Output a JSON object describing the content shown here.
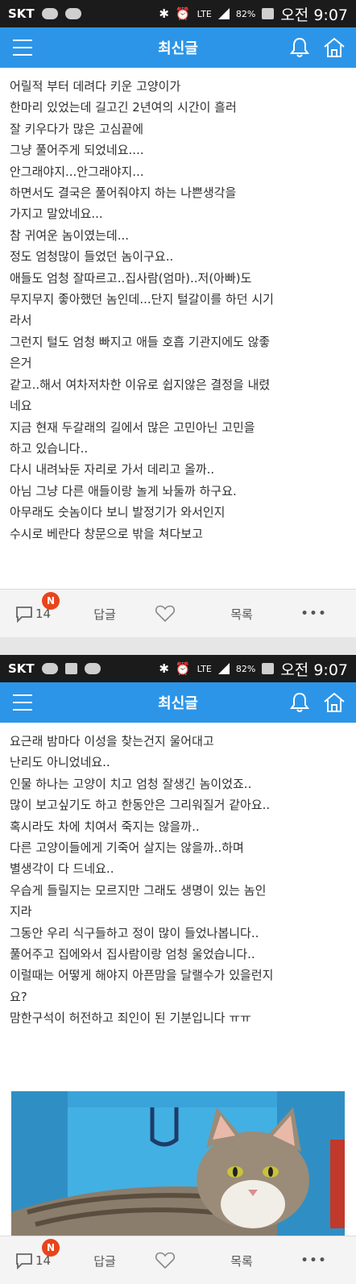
{
  "status_bar": {
    "carrier": "SKT",
    "network": "LTE",
    "battery": "82%",
    "time": "오전 9:07"
  },
  "header": {
    "title": "최신글"
  },
  "post": {
    "paragraphs_part1": [
      "어릴적 부터 데려다 키운 고양이가",
      "한마리 있었는데 길고긴 2년여의 시간이 흘러",
      "잘 키우다가 많은 고심끝에",
      "그냥 풀어주게 되었네요....",
      "안그래야지...안그래야지...",
      "하면서도 결국은 풀어줘야지 하는 나쁜생각을",
      "가지고 말았네요...",
      "참 귀여운 놈이였는데...",
      "정도 엄청많이 들었던 놈이구요..",
      "애들도 엄청 잘따르고..집사람(엄마)..저(아빠)도",
      "무지무지 좋아했던 놈인데...단지 털갈이를 하던 시기",
      "라서",
      "그런지 털도 엄청 빠지고 애들 호흡 기관지에도 않좋",
      "은거",
      "같고..해서 여차저차한 이유로 쉽지않은 결정을 내렸",
      "네요",
      "지금 현재 두갈래의 길에서 많은 고민아닌 고민을",
      "하고 있습니다..",
      "다시 내려놔둔 자리로 가서 데리고 올까..",
      "아님 그냥 다른 애들이랑 놀게 놔둘까 하구요.",
      "아무래도 숫놈이다 보니 발정기가 와서인지",
      "수시로 베란다 창문으로 밖을 쳐다보고"
    ],
    "paragraphs_part2": [
      "요근래 밤마다 이성을 찾는건지 울어대고",
      "난리도 아니었네요..",
      "인물 하나는 고양이 치고 엄청 잘생긴 놈이었죠..",
      "많이 보고싶기도 하고 한동안은 그리워질거 같아요..",
      "혹시라도 차에 치여서 죽지는 않을까..",
      "다른 고양이들에게 기죽어 살지는 않을까..하며",
      "별생각이 다 드네요..",
      "우습게 들릴지는 모르지만 그래도 생명이 있는 놈인",
      "지라",
      "그동안 우리 식구들하고 정이 많이 들었나봅니다..",
      "풀어주고 집에와서 집사람이랑 엄청 울었습니다..",
      "이럴때는 어떻게 해야지 아픈맘을 달랠수가 있을런지",
      "요?",
      "맘한구석이 허전하고 죄인이 된 기분입니다 ㅠㅠ"
    ]
  },
  "bottom_bar": {
    "comment_count": "14",
    "new_badge": "N",
    "reply_label": "답글",
    "list_label": "목록",
    "more_label": "•••"
  },
  "colors": {
    "header_blue": "#2c95e8",
    "badge_red": "#e8441c",
    "statusbar": "#1b1b1b"
  },
  "icons": [
    "menu-icon",
    "bell-icon",
    "home-icon",
    "comment-icon",
    "heart-icon",
    "more-icon"
  ]
}
